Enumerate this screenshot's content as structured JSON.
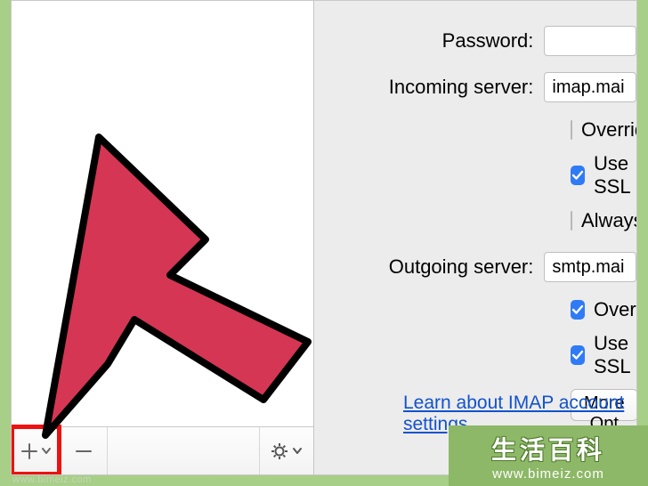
{
  "form": {
    "password_label": "Password:",
    "password_value": "",
    "incoming_label": "Incoming server:",
    "incoming_value": "imap.mai",
    "override_in_label": "Override",
    "use_ssl_in_label": "Use SSL",
    "always_label": "Always",
    "outgoing_label": "Outgoing server:",
    "outgoing_value": "smtp.mai",
    "override_out_label": "Override",
    "use_ssl_out_label": "Use SSL",
    "more_options_label": "More Opt"
  },
  "checkboxes": {
    "override_in": false,
    "use_ssl_in": true,
    "always": false,
    "override_out": true,
    "use_ssl_out": true
  },
  "link": {
    "imap_learn": "Learn about IMAP account settings"
  },
  "watermark": {
    "cn": "生活百科",
    "url": "www.bimeiz.com",
    "left": "www.bimeiz.com"
  }
}
